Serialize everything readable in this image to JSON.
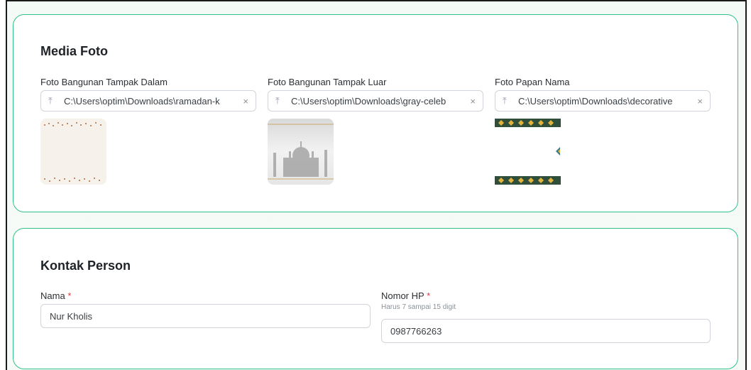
{
  "media": {
    "title": "Media Foto",
    "fields": [
      {
        "label": "Foto Bangunan Tampak Dalam",
        "path": "C:\\Users\\optim\\Downloads\\ramadan-k"
      },
      {
        "label": "Foto Bangunan Tampak Luar",
        "path": "C:\\Users\\optim\\Downloads\\gray-celeb"
      },
      {
        "label": "Foto Papan Nama",
        "path": "C:\\Users\\optim\\Downloads\\decorative"
      }
    ],
    "upload_icon": "upload-icon",
    "clear_icon": "close-icon",
    "upload_glyph": "⤒",
    "clear_glyph": "×"
  },
  "contact": {
    "title": "Kontak Person",
    "name_label": "Nama",
    "name_value": "Nur Kholis",
    "phone_label": "Nomor HP",
    "phone_helper": "Harus 7 sampai 15 digit",
    "phone_value": "0987766263",
    "required_mark": "*"
  },
  "colors": {
    "accent_border": "#34c08a",
    "required": "#e0393e"
  }
}
